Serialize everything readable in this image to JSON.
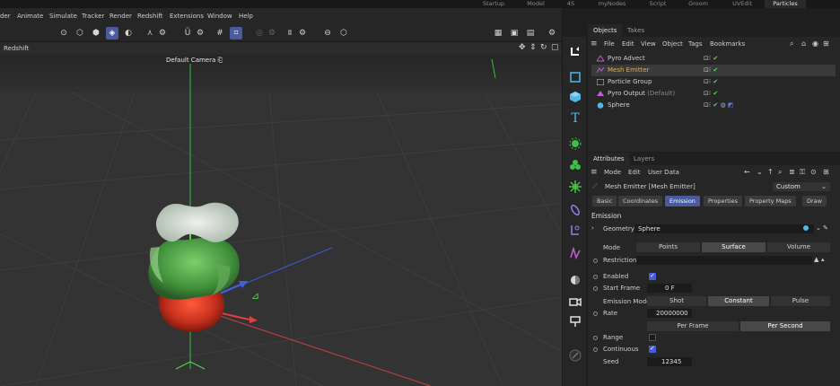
{
  "layout_tabs": [
    "Startup",
    "Model",
    "4S",
    "myNodes",
    "Script",
    "Groom",
    "UVEdit",
    "Particles"
  ],
  "active_layout": "Particles",
  "menus": [
    "der",
    "Animate",
    "Simulate",
    "Tracker",
    "Render",
    "Redshift",
    "Extensions",
    "Window",
    "Help"
  ],
  "viewport": {
    "header_label": "Redshift",
    "camera_label": "Default Camera",
    "camera_icon": "lock-icon"
  },
  "objects": {
    "tabs": [
      "Objects",
      "Takes"
    ],
    "menu": [
      "File",
      "Edit",
      "View",
      "Object",
      "Tags",
      "Bookmarks"
    ],
    "rows": [
      {
        "name": "Pyro Advect",
        "icon": "pyro-advect-icon",
        "color": "#c8c8c8",
        "suffix": ""
      },
      {
        "name": "Mesh Emitter",
        "icon": "emitter-icon",
        "color": "#e8b04a",
        "suffix": ""
      },
      {
        "name": "Particle Group",
        "icon": "group-icon",
        "color": "#c8c8c8",
        "suffix": ""
      },
      {
        "name": "Pyro Output",
        "icon": "pyro-output-icon",
        "color": "#c8c8c8",
        "suffix": "(Default)"
      },
      {
        "name": "Sphere",
        "icon": "sphere-icon",
        "color": "#4fb8e8",
        "suffix": ""
      }
    ]
  },
  "attributes": {
    "tabs": [
      "Attributes",
      "Layers"
    ],
    "menu": [
      "Mode",
      "Edit",
      "User Data"
    ],
    "object_title": "Mesh Emitter [Mesh Emitter]",
    "preset": "Custom",
    "sub_tabs": [
      "Basic",
      "Coordinates",
      "Emission",
      "Properties",
      "Property Maps",
      "Draw"
    ],
    "active_sub_tab": "Emission",
    "section": "Emission",
    "geometry_label": "Geometry",
    "geometry_value": "Sphere",
    "mode_label": "Mode",
    "mode_options": [
      "Points",
      "Surface",
      "Volume"
    ],
    "mode_selected": "Surface",
    "restriction_label": "Restriction",
    "enabled_label": "Enabled",
    "enabled": true,
    "start_frame_label": "Start Frame",
    "start_frame": "0 F",
    "emission_mode_label": "Emission Mode",
    "emission_mode_options": [
      "Shot",
      "Constant",
      "Pulse"
    ],
    "emission_mode_selected": "Constant",
    "rate_label": "Rate",
    "rate": "20000000",
    "rate_options": [
      "Per Frame",
      "Per Second"
    ],
    "rate_selected": "Per Second",
    "range_label": "Range",
    "range": false,
    "continuous_label": "Continuous",
    "continuous": true,
    "seed_label": "Seed",
    "seed": "12345"
  },
  "colors": {
    "accent": "#4a5a9c",
    "axis_x": "#d04040",
    "axis_y": "#40c040",
    "axis_z": "#4060d0"
  }
}
